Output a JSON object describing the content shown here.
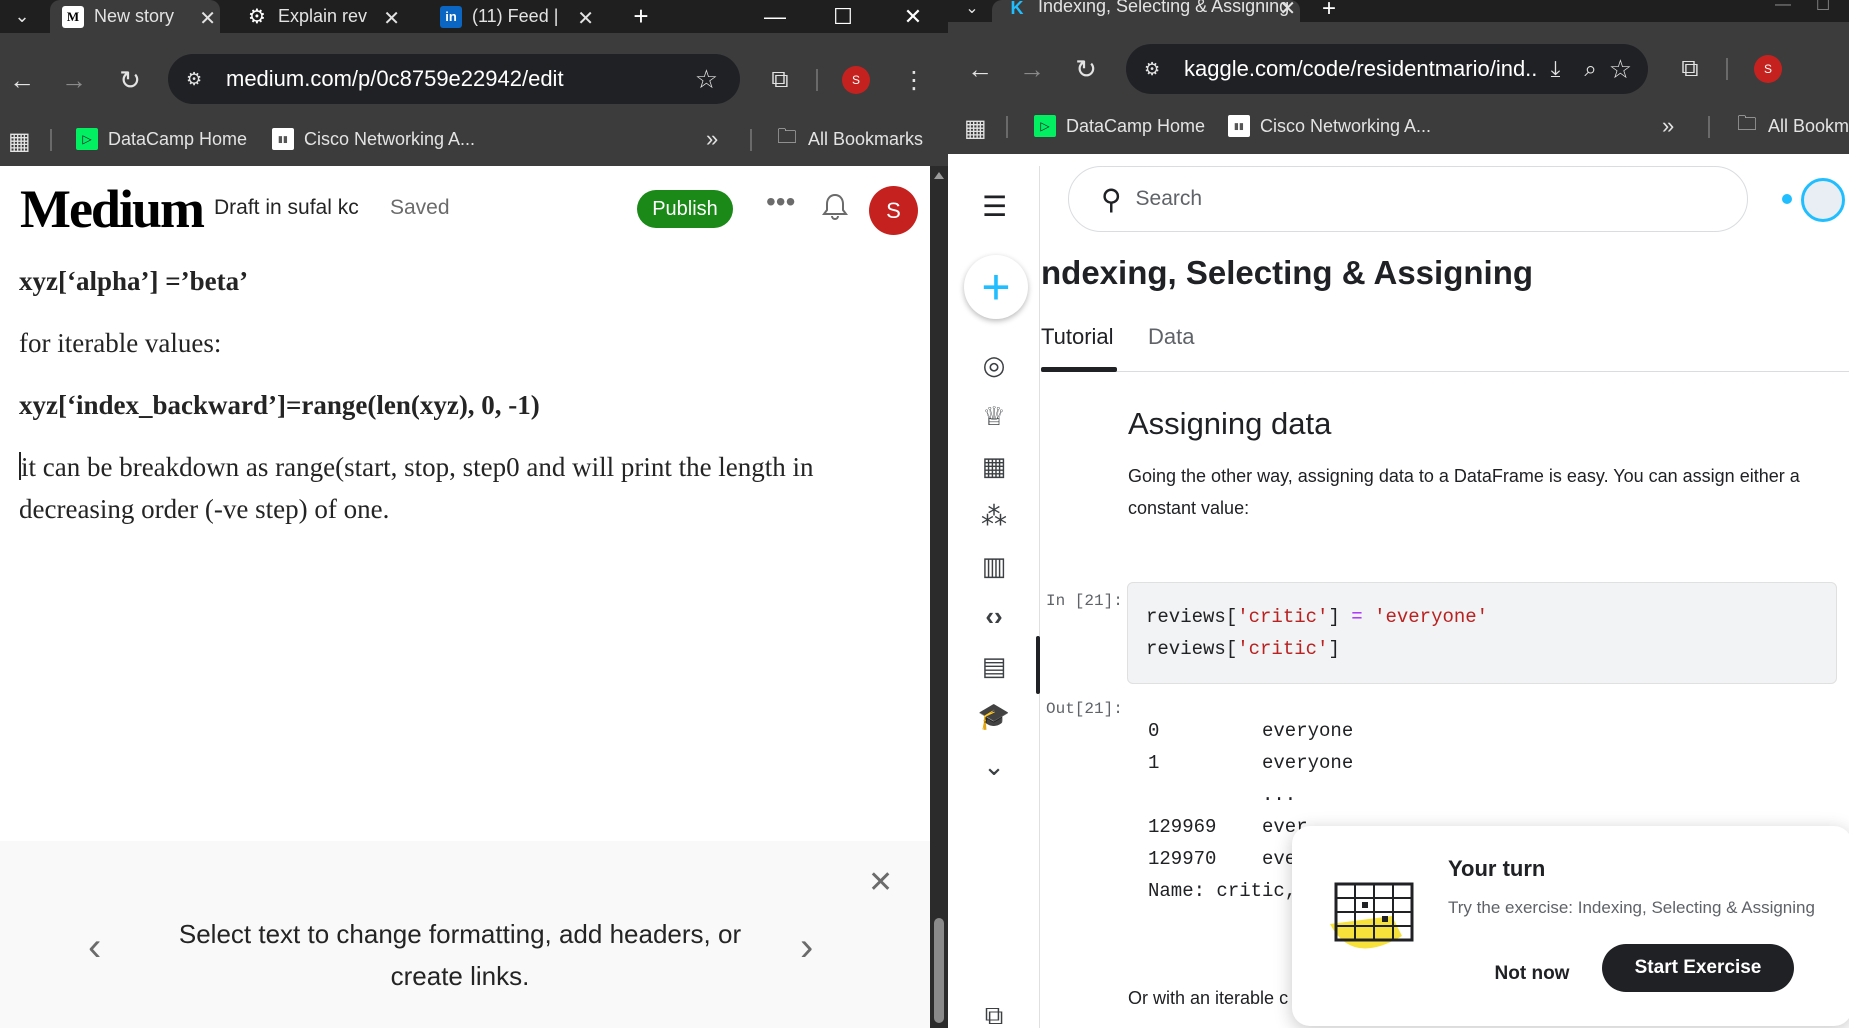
{
  "left": {
    "tabs": [
      {
        "label": "New story",
        "favicon": "M"
      },
      {
        "label": "Explain rev",
        "favicon": "chatgpt-icon"
      },
      {
        "label": "(11) Feed |",
        "favicon": "in"
      }
    ],
    "url": "medium.com/p/0c8759e22942/edit",
    "profile_initial": "S",
    "bookmarks": [
      "DataCamp Home",
      "Cisco Networking A...",
      "All Bookmarks"
    ],
    "medium": {
      "logo": "Medium",
      "draft": "Draft in sufal kc",
      "saved": "Saved",
      "publish": "Publish",
      "avatar": "S",
      "paragraphs": [
        "xyz[‘alpha’] =’beta’",
        "for iterable values:",
        "xyz[‘index_backward’]=range(len(xyz), 0, -1)",
        "it can be breakdown as range(start, stop, step0 and will print the length in decreasing order (-ve step) of one."
      ],
      "hint": "Select text to change formatting, add headers, or create links."
    }
  },
  "right": {
    "tab": "Indexing, Selecting & Assigning",
    "tab_favicon": "K",
    "url": "kaggle.com/code/residentmario/ind...",
    "profile_initial": "S",
    "bookmarks": [
      "DataCamp Home",
      "Cisco Networking A...",
      "All Bookm"
    ],
    "kaggle": {
      "search_placeholder": "Search",
      "title": "ndexing, Selecting & Assigning",
      "tabs": [
        "Tutorial",
        "Data"
      ],
      "heading": "Assigning data",
      "paragraph": "Going the other way, assigning data to a DataFrame is easy. You can assign either a constant value:",
      "in_prompt": "In [21]:",
      "out_prompt": "Out[21]:",
      "code_line1": {
        "a": "reviews[",
        "b": "'critic'",
        "c": "] ",
        "d": "=",
        "e": " ",
        "f": "'everyone'"
      },
      "code_line2": {
        "a": "reviews[",
        "b": "'critic'",
        "c": "]"
      },
      "output_rows": [
        {
          "idx": "0",
          "val": "everyone"
        },
        {
          "idx": "1",
          "val": "everyone"
        },
        {
          "idx": "",
          "val": "  ..."
        },
        {
          "idx": "129969",
          "val": "ever"
        },
        {
          "idx": "129970",
          "val": "eve"
        },
        {
          "idx": "Name: critic,",
          "val": ""
        }
      ],
      "after_text": "Or with an iterable c",
      "popup": {
        "title": "Your turn",
        "subtitle": "Try the exercise: Indexing, Selecting & Assigning",
        "not_now": "Not now",
        "start": "Start Exercise"
      }
    }
  },
  "colors": {
    "publish_green": "#1a8917",
    "kaggle_blue": "#20beff",
    "avatar_red": "#c5221f"
  }
}
